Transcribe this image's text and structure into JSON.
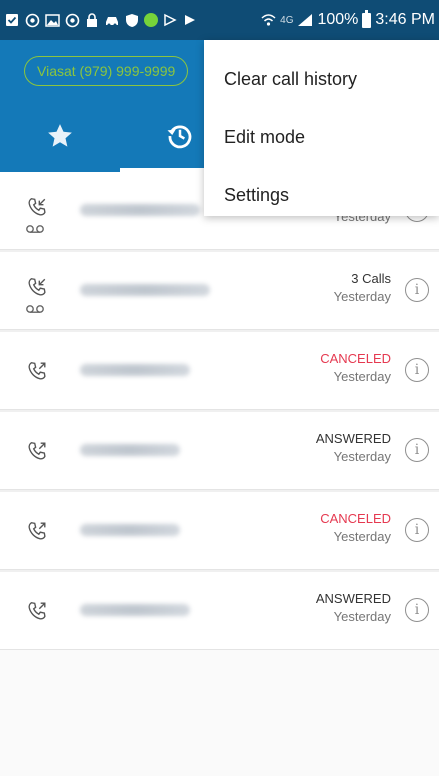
{
  "status_bar": {
    "icons": [
      "checkbox-icon",
      "ring-icon",
      "image-icon",
      "ring-icon",
      "lock-icon",
      "car-icon",
      "shield-icon",
      "green-dot-icon",
      "play-icon",
      "forward-icon"
    ],
    "net_label": "4G",
    "battery": "100%",
    "time": "3:46 PM"
  },
  "header": {
    "account": "Viasat (979) 999-9999",
    "tabs": [
      {
        "name": "favorites",
        "icon": "star-icon"
      },
      {
        "name": "recents",
        "icon": "history-icon"
      }
    ]
  },
  "menu": {
    "items": [
      "Clear call history",
      "Edit mode",
      "Settings"
    ]
  },
  "calls": [
    {
      "type": "incoming",
      "voicemail": true,
      "status": "",
      "time": "Yesterday"
    },
    {
      "type": "incoming",
      "voicemail": true,
      "status": "3 Calls",
      "time": "Yesterday"
    },
    {
      "type": "outgoing",
      "voicemail": false,
      "status": "CANCELED",
      "time": "Yesterday"
    },
    {
      "type": "outgoing",
      "voicemail": false,
      "status": "ANSWERED",
      "time": "Yesterday"
    },
    {
      "type": "outgoing",
      "voicemail": false,
      "status": "CANCELED",
      "time": "Yesterday"
    },
    {
      "type": "outgoing",
      "voicemail": false,
      "status": "ANSWERED",
      "time": "Yesterday"
    }
  ],
  "colors": {
    "status_bar": "#0f4c75",
    "header": "#1479b8",
    "accent_green": "#8bc53f",
    "canceled_red": "#e53950"
  }
}
